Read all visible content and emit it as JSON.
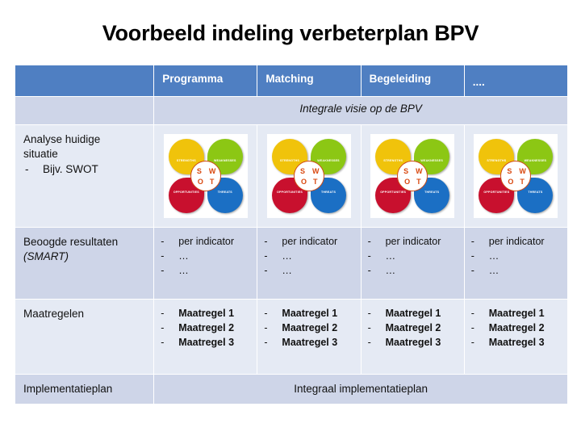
{
  "slide": {
    "title": "Voorbeeld indeling verbeterplan BPV"
  },
  "table": {
    "header": {
      "corner": "",
      "columns": [
        "Programma",
        "Matching",
        "Begeleiding",
        "...."
      ]
    },
    "rows": [
      {
        "id": "visie",
        "label": "",
        "merged_text": "Integrale visie op de BPV",
        "style": "italic-center"
      },
      {
        "id": "analyse",
        "label_line1": "Analyse huidige",
        "label_line2": "situatie",
        "label_bullet_dash": "-",
        "label_bullet_text": "Bijv. SWOT",
        "cells": [
          "swot-image",
          "swot-image",
          "swot-image",
          "swot-image"
        ]
      },
      {
        "id": "resultaten",
        "label_line1": "Beoogde resultaten",
        "label_line2": "(SMART)",
        "items": [
          {
            "dash": "-",
            "text": "per indicator"
          },
          {
            "dash": "-",
            "text": "…"
          },
          {
            "dash": "-",
            "text": "…"
          }
        ]
      },
      {
        "id": "maatregelen",
        "label_line1": "Maatregelen",
        "items": [
          {
            "dash": "-",
            "text": "Maatregel 1"
          },
          {
            "dash": "-",
            "text": "Maatregel 2"
          },
          {
            "dash": "-",
            "text": "Maatregel 3"
          }
        ]
      },
      {
        "id": "implementatie",
        "label": "Implementatieplan",
        "merged_text": "Integraal implementatieplan"
      }
    ]
  },
  "swot": {
    "petals": [
      {
        "key": "strengths",
        "label": "STRENGTHS",
        "color": "#f0c30b"
      },
      {
        "key": "weaknesses",
        "label": "WEAKNESSES",
        "color": "#8cc714"
      },
      {
        "key": "opportunities",
        "label": "OPPORTUNITIES",
        "color": "#c8102e"
      },
      {
        "key": "threats",
        "label": "THREATS",
        "color": "#1b6fc4"
      }
    ],
    "center": {
      "s": "S",
      "w": "W",
      "o": "O",
      "t": "T"
    }
  },
  "colors": {
    "header_blue": "#4f7fc2",
    "band_dark": "#ced5e8",
    "band_light": "#e5eaf4",
    "text": "#111111"
  }
}
